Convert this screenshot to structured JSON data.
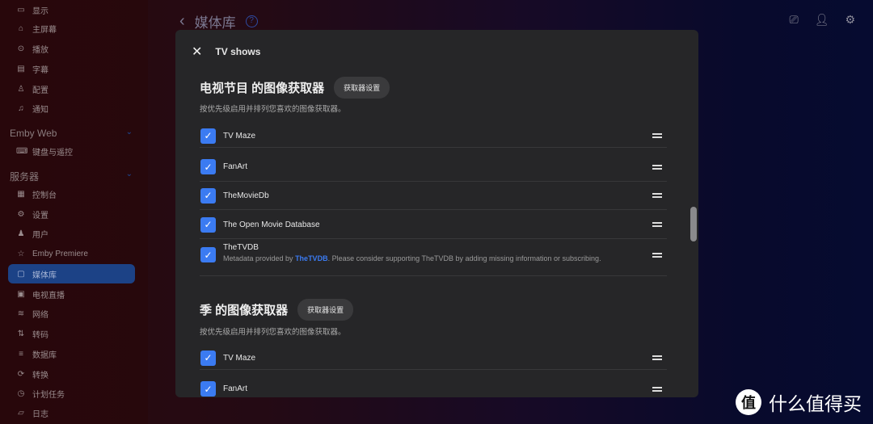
{
  "sidebar": {
    "items_a": [
      {
        "icon": "monitor-icon",
        "label": "显示"
      },
      {
        "icon": "home-icon",
        "label": "主屏幕"
      },
      {
        "icon": "play-circle-icon",
        "label": "播放"
      },
      {
        "icon": "subtitles-icon",
        "label": "字幕"
      },
      {
        "icon": "user-profile-icon",
        "label": "配置"
      },
      {
        "icon": "bell-icon",
        "label": "通知"
      }
    ],
    "section_web": "Emby Web",
    "items_b": [
      {
        "icon": "keyboard-icon",
        "label": "键盘与遥控"
      }
    ],
    "section_server": "服务器",
    "items_c": [
      {
        "icon": "dashboard-icon",
        "label": "控制台"
      },
      {
        "icon": "gear-icon",
        "label": "设置"
      },
      {
        "icon": "users-icon",
        "label": "用户"
      },
      {
        "icon": "star-icon",
        "label": "Emby Premiere"
      },
      {
        "icon": "folder-icon",
        "label": "媒体库",
        "active": true
      },
      {
        "icon": "tv-icon",
        "label": "电视直播"
      },
      {
        "icon": "wifi-icon",
        "label": "网络"
      },
      {
        "icon": "transcode-icon",
        "label": "转码"
      },
      {
        "icon": "database-icon",
        "label": "数据库"
      },
      {
        "icon": "convert-icon",
        "label": "转换"
      },
      {
        "icon": "clock-icon",
        "label": "计划任务"
      },
      {
        "icon": "folder-open-icon",
        "label": "日志"
      }
    ]
  },
  "header": {
    "title": "媒体库",
    "help": "?"
  },
  "dialog": {
    "title": "TV shows",
    "sections": [
      {
        "heading": "电视节目 的图像获取器",
        "button": "获取器设置",
        "desc": "按优先级启用并排列您喜欢的图像获取器。",
        "rows": [
          {
            "name": "TV Maze",
            "checked": true
          },
          {
            "name": "FanArt",
            "checked": true
          },
          {
            "name": "TheMovieDb",
            "checked": true
          },
          {
            "name": "The Open Movie Database",
            "checked": true
          },
          {
            "name": "TheTVDB",
            "checked": true,
            "sub_pre": "Metadata provided by ",
            "sub_link": "TheTVDB",
            "sub_post": ". Please consider supporting TheTVDB by adding missing information or subscribing."
          }
        ]
      },
      {
        "heading": "季 的图像获取器",
        "button": "获取器设置",
        "desc": "按优先级启用并排列您喜欢的图像获取器。",
        "rows": [
          {
            "name": "TV Maze",
            "checked": true
          },
          {
            "name": "FanArt",
            "checked": true
          }
        ]
      }
    ]
  },
  "watermark": {
    "logo": "值",
    "text": "什么值得买"
  },
  "colors": {
    "accent": "#3b7bf2",
    "active_nav": "#1c4286",
    "dialog_bg": "#262628"
  }
}
